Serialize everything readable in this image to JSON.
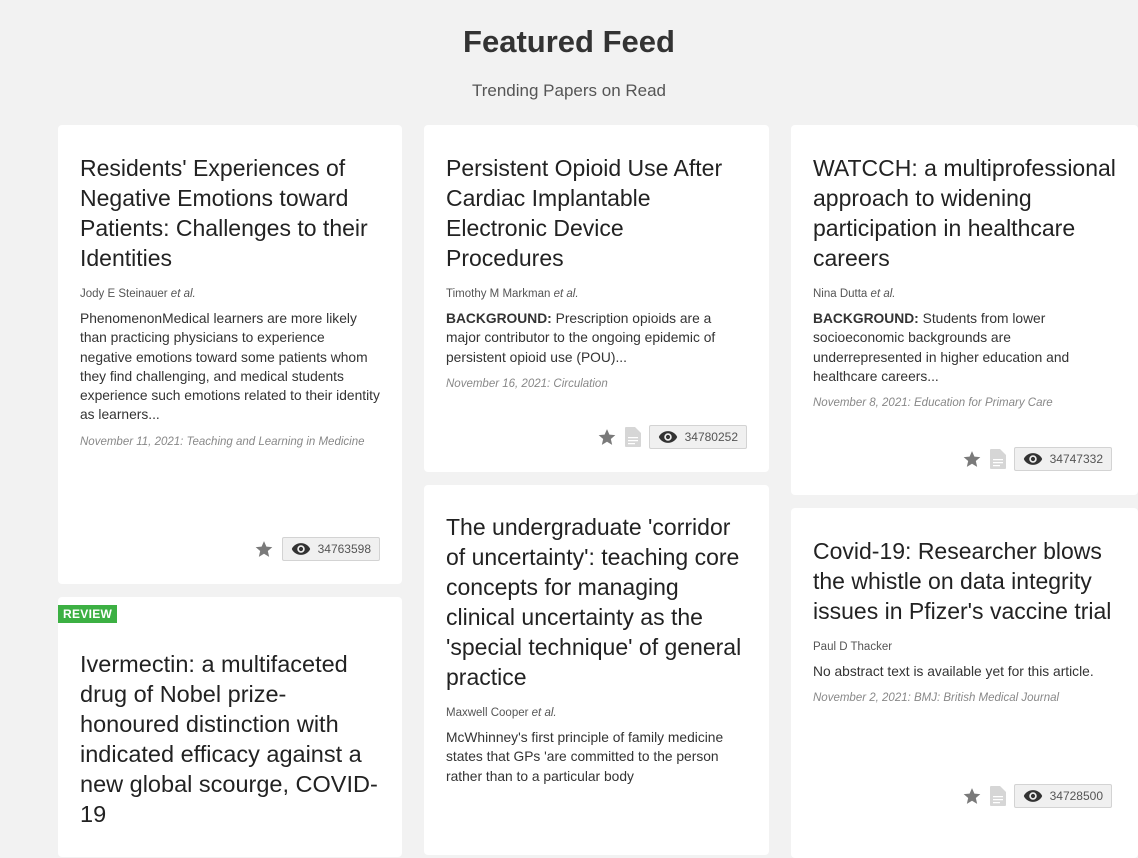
{
  "header": {
    "title": "Featured Feed",
    "subtitle": "Trending Papers on Read"
  },
  "cards": [
    {
      "title": "Residents' Experiences of Negative Emotions toward Patients: Challenges to their Identities",
      "author": "Jody E Steinauer",
      "etal": "et al.",
      "abstract": "PhenomenonMedical learners are more likely than practicing physicians to experience negative emotions toward some patients whom they find challenging, and medical students experience such emotions related to their identity as learners...",
      "meta": "November 11, 2021: Teaching and Learning in Medicine",
      "views": "34763598",
      "star_icon": "star-icon",
      "eye_icon": "eye-icon"
    },
    {
      "title": "Persistent Opioid Use After Cardiac Implantable Electronic Device Procedures",
      "author": "Timothy M Markman",
      "etal": "et al.",
      "abstract_lead": "BACKGROUND:",
      "abstract": "Prescription opioids are a major contributor to the ongoing epidemic of persistent opioid use (POU)...",
      "meta": "November 16, 2021: Circulation",
      "views": "34780252",
      "star_icon": "star-icon",
      "doc_icon": "document-icon",
      "eye_icon": "eye-icon"
    },
    {
      "title": "WATCCH: a multiprofessional approach to widening participation in healthcare careers",
      "author": "Nina Dutta",
      "etal": "et al.",
      "abstract_lead": "BACKGROUND:",
      "abstract": "Students from lower socioeconomic backgrounds are underrepresented in higher education and healthcare careers...",
      "meta": "November 8, 2021: Education for Primary Care",
      "views": "34747332",
      "star_icon": "star-icon",
      "doc_icon": "document-icon",
      "eye_icon": "eye-icon"
    },
    {
      "badge": "REVIEW",
      "title": "Ivermectin: a multifaceted drug of Nobel prize-honoured distinction with indicated efficacy against a new global scourge, COVID-19"
    },
    {
      "title": "The undergraduate 'corridor of uncertainty': teaching core concepts for managing clinical uncertainty as the 'special technique' of general practice",
      "author": "Maxwell Cooper",
      "etal": "et al.",
      "abstract": "McWhinney's first principle of family medicine states that GPs 'are committed to the person rather than to a particular body"
    },
    {
      "title": "Covid-19: Researcher blows the whistle on data integrity issues in Pfizer's vaccine trial",
      "author": "Paul D Thacker",
      "abstract": "No abstract text is available yet for this article.",
      "meta": "November 2, 2021: BMJ: British Medical Journal",
      "views": "34728500",
      "star_icon": "star-icon",
      "doc_icon": "document-icon",
      "eye_icon": "eye-icon"
    }
  ],
  "colors": {
    "background": "#f2f2f2",
    "card": "#ffffff",
    "badge": "#3cb043",
    "icon_gray": "#7a7a7a"
  }
}
